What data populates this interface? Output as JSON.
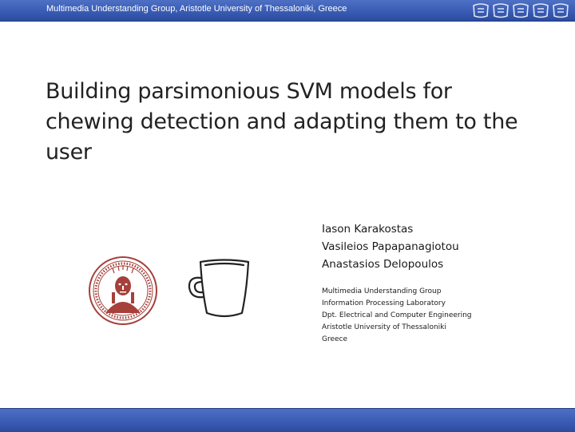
{
  "header": {
    "text": "Multimedia Understanding Group, Aristotle University of Thessaloniki, Greece",
    "logo_icon": "mug-group-logos",
    "color": "#3a5cb4"
  },
  "title": "Building parsimonious SVM models for chewing detection and adapting them to the user",
  "authors": [
    "Iason Karakostas",
    "Vasileios Papapanagiotou",
    "Anastasios Delopoulos"
  ],
  "affiliation": [
    "Multimedia Understanding Group",
    "Information Processing Laboratory",
    "Dpt. Electrical and Computer Engineering",
    "Aristotle University of Thessaloniki",
    "Greece"
  ],
  "images": {
    "seal_icon": "university-seal-icon",
    "seal_color": "#a5403a",
    "cup_icon": "cup-icon"
  }
}
